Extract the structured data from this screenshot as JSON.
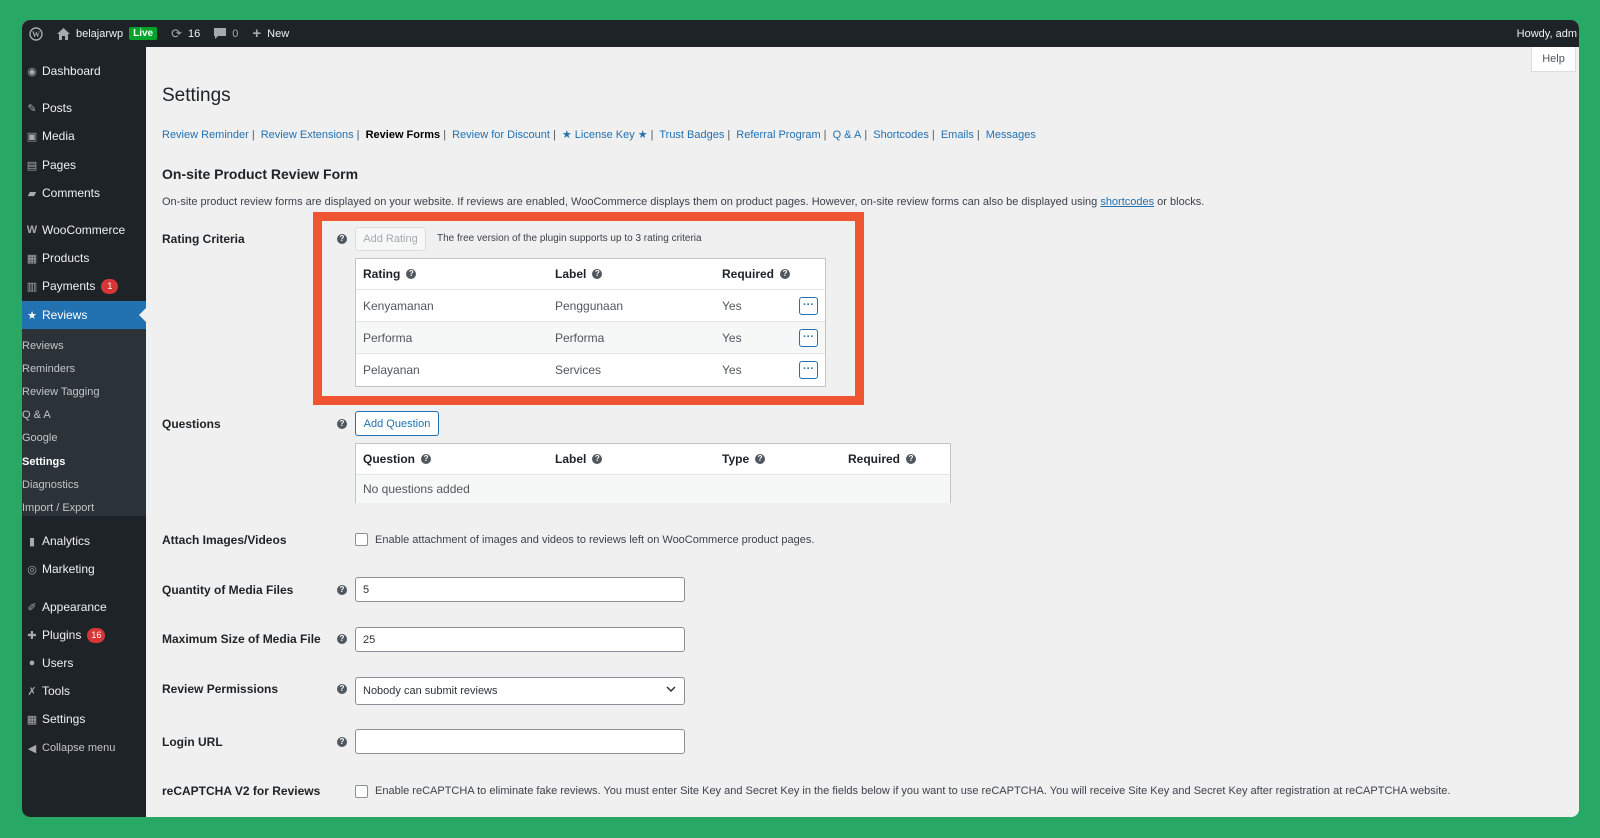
{
  "admin_bar": {
    "site_name": "belajarwp",
    "live_label": "Live",
    "updates_count": "16",
    "comments_count": "0",
    "new_label": "New",
    "howdy": "Howdy, adm"
  },
  "sidebar": {
    "items": [
      {
        "label": "Dashboard",
        "icon": "dashboard-icon"
      },
      {
        "label": "Posts",
        "icon": "pin-icon"
      },
      {
        "label": "Media",
        "icon": "media-icon"
      },
      {
        "label": "Pages",
        "icon": "page-icon"
      },
      {
        "label": "Comments",
        "icon": "comment-icon"
      },
      {
        "label": "WooCommerce",
        "icon": "woocommerce-icon"
      },
      {
        "label": "Products",
        "icon": "archive-icon"
      },
      {
        "label": "Payments",
        "icon": "payment-icon",
        "badge": "1"
      },
      {
        "label": "Reviews",
        "icon": "star-icon"
      },
      {
        "label": "Analytics",
        "icon": "chart-icon"
      },
      {
        "label": "Marketing",
        "icon": "megaphone-icon"
      },
      {
        "label": "Appearance",
        "icon": "brush-icon"
      },
      {
        "label": "Plugins",
        "icon": "plugin-icon",
        "badge": "16"
      },
      {
        "label": "Users",
        "icon": "users-icon"
      },
      {
        "label": "Tools",
        "icon": "wrench-icon"
      },
      {
        "label": "Settings",
        "icon": "settings-icon"
      },
      {
        "label": "Collapse menu",
        "icon": "collapse-icon"
      }
    ],
    "submenu": [
      "Reviews",
      "Reminders",
      "Review Tagging",
      "Q & A",
      "Google",
      "Settings",
      "Diagnostics",
      "Import / Export"
    ]
  },
  "help_label": "Help",
  "page_title": "Settings",
  "tabs": [
    "Review Reminder",
    "Review Extensions",
    "Review Forms",
    "Review for Discount",
    "★ License Key ★",
    "Trust Badges",
    "Referral Program",
    "Q & A",
    "Shortcodes",
    "Emails",
    "Messages"
  ],
  "section": {
    "title": "On-site Product Review Form",
    "desc_before": "On-site product review forms are displayed on your website. If reviews are enabled, WooCommerce displays them on product pages. However, on-site review forms can also be displayed using ",
    "desc_link": "shortcodes",
    "desc_after": " or blocks."
  },
  "rating_criteria": {
    "label": "Rating Criteria",
    "add_button": "Add Rating",
    "note": "The free version of the plugin supports up to 3 rating criteria",
    "headers": [
      "Rating",
      "Label",
      "Required"
    ],
    "rows": [
      {
        "rating": "Kenyamanan",
        "label": "Penggunaan",
        "required": "Yes"
      },
      {
        "rating": "Performa",
        "label": "Performa",
        "required": "Yes"
      },
      {
        "rating": "Pelayanan",
        "label": "Services",
        "required": "Yes"
      }
    ]
  },
  "questions": {
    "label": "Questions",
    "add_button": "Add Question",
    "headers": [
      "Question",
      "Label",
      "Type",
      "Required"
    ],
    "empty": "No questions added"
  },
  "attach": {
    "label": "Attach Images/Videos",
    "checkbox_label": "Enable attachment of images and videos to reviews left on WooCommerce product pages."
  },
  "quantity": {
    "label": "Quantity of Media Files",
    "value": "5"
  },
  "max_size": {
    "label": "Maximum Size of Media File",
    "value": "25"
  },
  "permissions": {
    "label": "Review Permissions",
    "value": "Nobody can submit reviews"
  },
  "login_url": {
    "label": "Login URL",
    "value": ""
  },
  "recaptcha": {
    "label": "reCAPTCHA V2 for Reviews",
    "checkbox_label": "Enable reCAPTCHA to eliminate fake reviews. You must enter Site Key and Secret Key in the fields below if you want to use reCAPTCHA. You will receive Site Key and Secret Key after registration at reCAPTCHA website."
  },
  "colors": {
    "background": "#27a864",
    "accent": "#2271b1",
    "highlight": "#ef5533",
    "admin_dark": "#1d2327"
  }
}
